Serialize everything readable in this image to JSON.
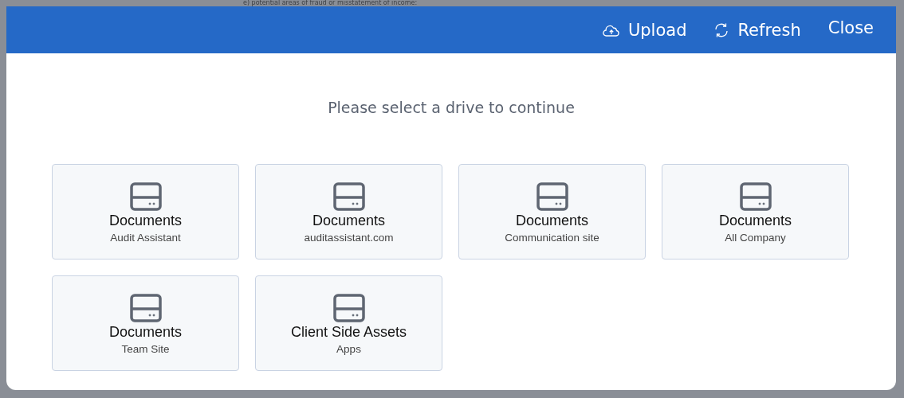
{
  "background_text": "e) potential areas of fraud or misstatement of income:",
  "toolbar": {
    "buttons": [
      {
        "kind": "upload",
        "label": "Upload"
      },
      {
        "kind": "refresh",
        "label": "Refresh"
      },
      {
        "kind": "close",
        "label": "Close"
      }
    ]
  },
  "prompt": "Please select a drive to continue",
  "drives": [
    {
      "name": "Documents",
      "site": "Audit Assistant"
    },
    {
      "name": "Documents",
      "site": "auditassistant.com"
    },
    {
      "name": "Documents",
      "site": "Communication site"
    },
    {
      "name": "Documents",
      "site": "All Company"
    },
    {
      "name": "Documents",
      "site": "Team Site"
    },
    {
      "name": "Client Side Assets",
      "site": "Apps"
    }
  ]
}
